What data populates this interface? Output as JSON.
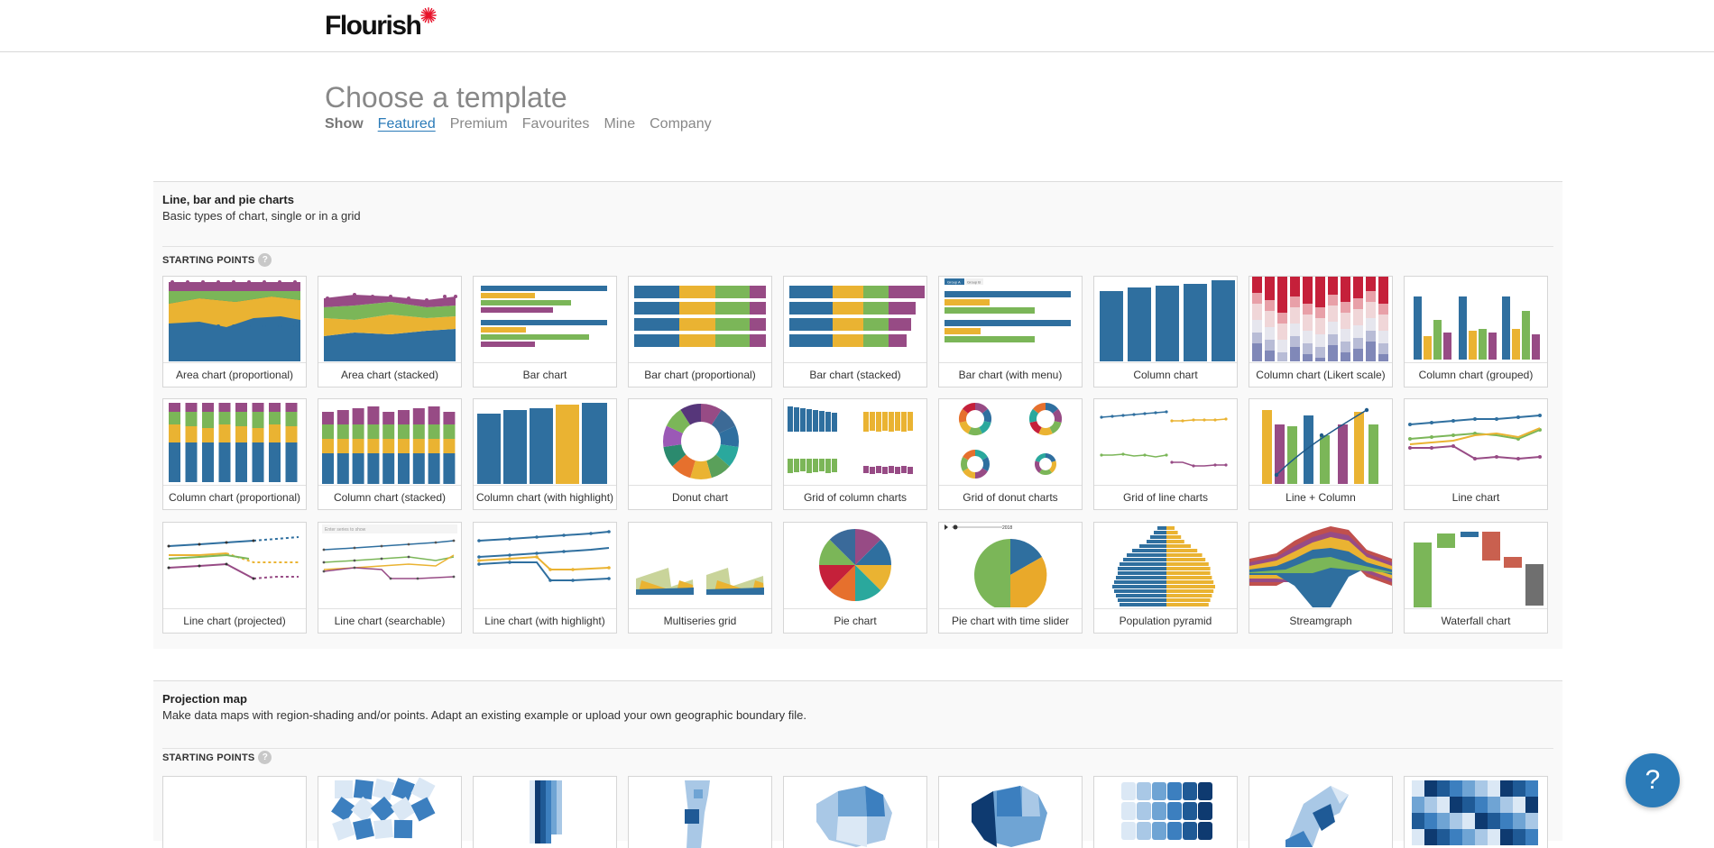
{
  "app": {
    "logo_text": "Flourish",
    "brand_color": "#e8122a"
  },
  "page": {
    "title": "Choose a template",
    "filter_label": "Show",
    "tabs": [
      {
        "label": "Featured",
        "active": true
      },
      {
        "label": "Premium",
        "active": false
      },
      {
        "label": "Favourites",
        "active": false
      },
      {
        "label": "Mine",
        "active": false
      },
      {
        "label": "Company",
        "active": false
      }
    ]
  },
  "sections": [
    {
      "title": "Line, bar and pie charts",
      "description": "Basic types of chart, single or in a grid",
      "starting_points_label": "STARTING POINTS",
      "templates": [
        "Area chart (proportional)",
        "Area chart (stacked)",
        "Bar chart",
        "Bar chart (proportional)",
        "Bar chart (stacked)",
        "Bar chart (with menu)",
        "Column chart",
        "Column chart (Likert scale)",
        "Column chart (grouped)",
        "Column chart (proportional)",
        "Column chart (stacked)",
        "Column chart (with highlight)",
        "Donut chart",
        "Grid of column charts",
        "Grid of donut charts",
        "Grid of line charts",
        "Line + Column",
        "Line chart",
        "Line chart (projected)",
        "Line chart (searchable)",
        "Line chart (with highlight)",
        "Multiseries grid",
        "Pie chart",
        "Pie chart with time slider",
        "Population pyramid",
        "Streamgraph",
        "Waterfall chart"
      ]
    },
    {
      "title": "Projection map",
      "description": "Make data maps with region-shading and/or points. Adapt an existing example or upload your own geographic boundary file.",
      "starting_points_label": "STARTING POINTS",
      "map_count": 9
    }
  ],
  "thumb_texts": {
    "menu_group_a": "Group A",
    "menu_group_b": "Group B",
    "search_placeholder": "Enter series to show",
    "slider_year": "2018"
  },
  "help": {
    "label": "?"
  },
  "palette": {
    "blue": "#2f6f9f",
    "yellow": "#eab332",
    "green": "#7bb658",
    "purple": "#974b85",
    "red": "#c5203a",
    "teal": "#2aa89d",
    "orange": "#e6702d",
    "map_blue": "#1f5a96"
  }
}
